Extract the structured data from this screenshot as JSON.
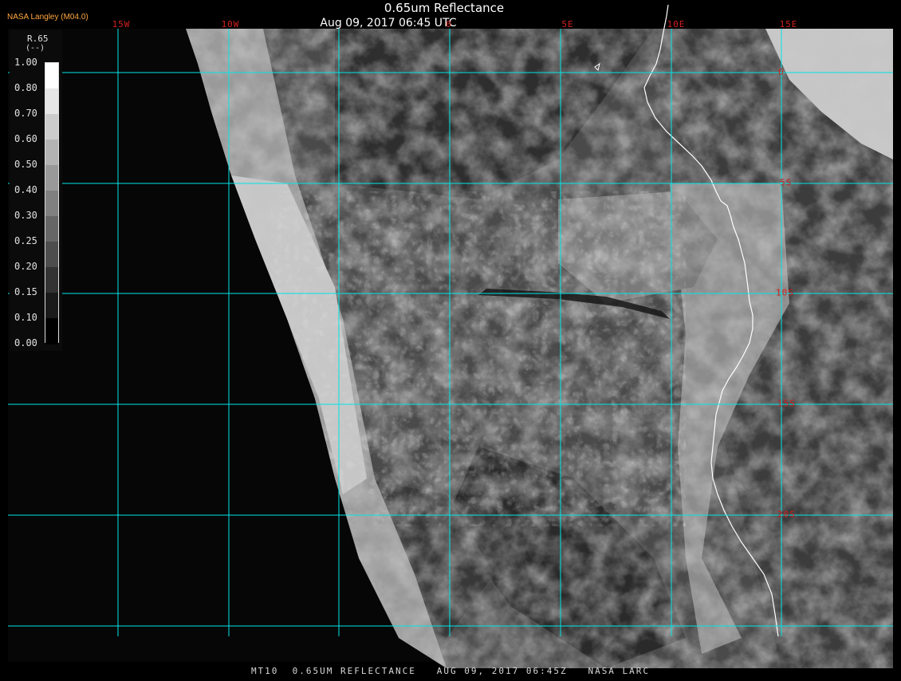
{
  "header": {
    "title": "0.65um Reflectance",
    "timestamp": "Aug 09, 2017 06:45 UTC",
    "credit": "NASA Langley (M04.0)"
  },
  "footer": {
    "text": "MT10  0.65UM REFLECTANCE   AUG 09, 2017 06:45Z   NASA LARC"
  },
  "legend": {
    "title": "R.65",
    "units": "(--)",
    "ticks": [
      "1.00",
      "0.80",
      "0.70",
      "0.60",
      "0.50",
      "0.40",
      "0.30",
      "0.25",
      "0.20",
      "0.15",
      "0.10",
      "0.00"
    ]
  },
  "graticule": {
    "longitudes": [
      "15W",
      "10W",
      "0",
      "5E",
      "10E",
      "15E"
    ],
    "latitudes": [
      "0",
      "5S",
      "10S",
      "15S",
      "20S"
    ],
    "line_color": "#00e5e5",
    "label_color": "#d02020"
  },
  "colors": {
    "background": "#000000",
    "coastline": "#ffffff",
    "credit": "#ffa640"
  }
}
